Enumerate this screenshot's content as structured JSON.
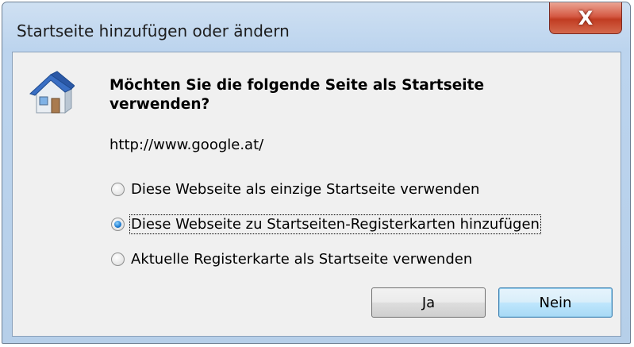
{
  "window": {
    "title": "Startseite hinzufügen oder ändern",
    "close_glyph": "X"
  },
  "dialog": {
    "icon": "house-icon",
    "question": "Möchten Sie die folgende Seite als Startseite verwenden?",
    "url": "http://www.google.at/",
    "options": [
      {
        "label": "Diese Webseite als einzige Startseite verwenden",
        "checked": false
      },
      {
        "label": "Diese Webseite zu Startseiten-Registerkarten hinzufügen",
        "checked": true
      },
      {
        "label": "Aktuelle Registerkarte als Startseite verwenden",
        "checked": false
      }
    ],
    "buttons": {
      "yes": "Ja",
      "no": "Nein"
    }
  },
  "colors": {
    "frame": "#bcd4ee",
    "close": "#c13c22",
    "radio_selected": "#1e7bd0"
  }
}
